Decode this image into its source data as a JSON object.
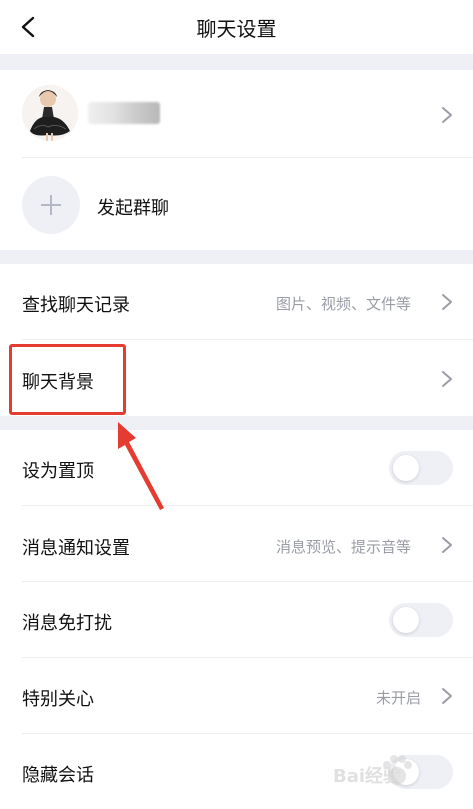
{
  "header": {
    "title": "聊天设置"
  },
  "profile": {
    "name_blurred": true
  },
  "group_chat": {
    "label": "发起群聊"
  },
  "rows": {
    "search_history": {
      "label": "查找聊天记录",
      "hint": "图片、视频、文件等"
    },
    "chat_background": {
      "label": "聊天背景"
    },
    "pin_top": {
      "label": "设为置顶",
      "toggle_on": false
    },
    "notification_settings": {
      "label": "消息通知设置",
      "hint": "消息预览、提示音等"
    },
    "do_not_disturb": {
      "label": "消息免打扰",
      "toggle_on": false
    },
    "special_care": {
      "label": "特别关心",
      "hint": "未开启"
    },
    "hide_chat": {
      "label": "隐藏会话"
    }
  },
  "watermark": {
    "text": "Bai经验"
  },
  "colors": {
    "accent_red": "#e53c32",
    "section_gap": "#eef0f6",
    "hint_gray": "#9a9da6"
  }
}
